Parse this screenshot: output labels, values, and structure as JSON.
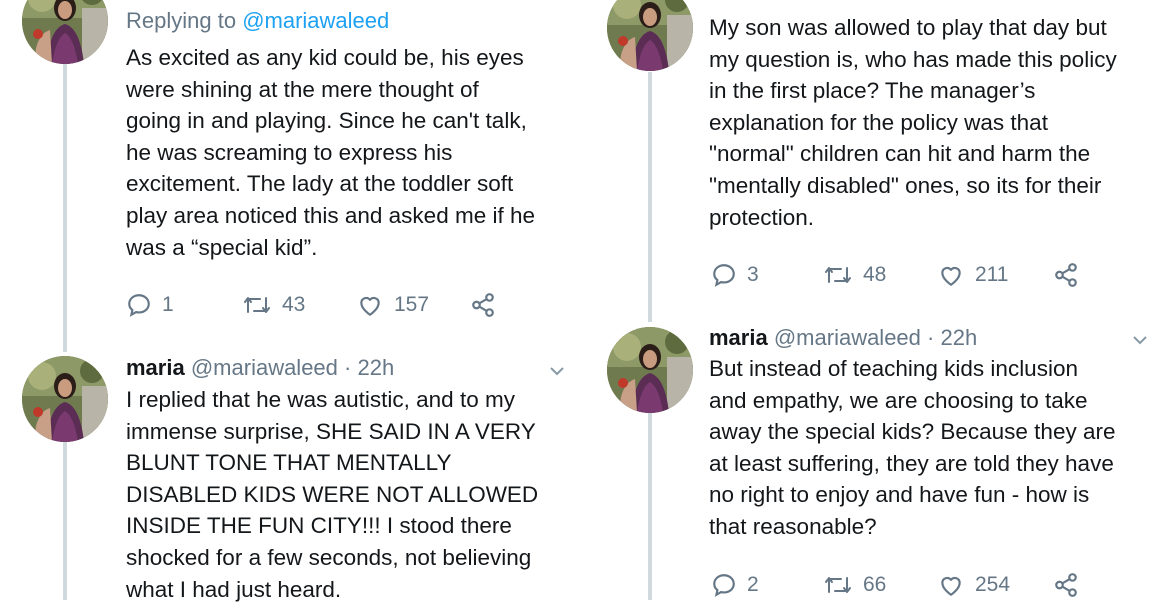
{
  "tweets": [
    {
      "column": "left",
      "reply_prefix": "Replying to ",
      "reply_mention": "@mariawaleed",
      "text": "As excited as any kid could be, his eyes\nwere shining at the mere thought of\ngoing in and playing. Since he can't talk,\nhe was screaming to express his\nexcitement. The lady at the toddler soft\nplay area noticed this and asked me if he\nwas a “special kid”.",
      "replies": "1",
      "retweets": "43",
      "likes": "157"
    },
    {
      "column": "left",
      "name": "maria",
      "handle": "@mariawaleed",
      "time": "· 22h",
      "text": "I replied that he was autistic, and to my\nimmense surprise, SHE SAID IN A VERY\nBLUNT TONE THAT MENTALLY\nDISABLED KIDS WERE NOT ALLOWED\nINSIDE THE FUN CITY!!! I stood there\nshocked for a few seconds, not believing\nwhat I had just heard."
    },
    {
      "column": "right",
      "text": "My son was allowed to play that day but\nmy question is, who has made this policy\nin the first place? The manager’s\nexplanation for the policy was that\n\"normal\" children can hit and harm the\n\"mentally disabled\" ones, so its for their\nprotection.",
      "replies": "3",
      "retweets": "48",
      "likes": "211"
    },
    {
      "column": "right",
      "name": "maria",
      "handle": "@mariawaleed",
      "time": "· 22h",
      "text": "But instead of teaching kids inclusion\nand empathy, we are choosing to take\naway the special kids? Because they are\nat least suffering, they are told they have\nno right to enjoy and have fun - how is\nthat reasonable?",
      "replies": "2",
      "retweets": "66",
      "likes": "254"
    }
  ],
  "icons": [
    "reply-icon",
    "retweet-icon",
    "like-icon",
    "share-icon",
    "chevron-down-icon"
  ],
  "colors": {
    "text": "#14171a",
    "secondary": "#657786",
    "link": "#1da1f2",
    "thread_line": "#cfd9de"
  }
}
